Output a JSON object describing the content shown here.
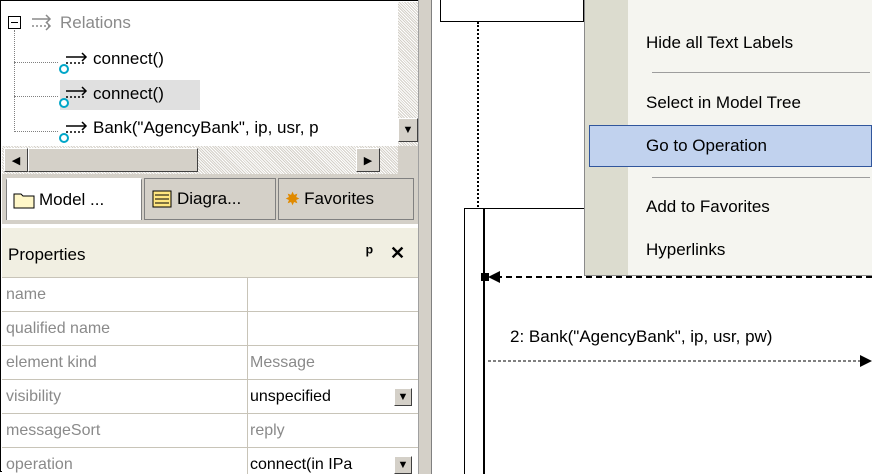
{
  "tree": {
    "group_label": "Relations",
    "items": [
      {
        "label": "connect()"
      },
      {
        "label": "connect()"
      },
      {
        "label": "Bank(\"AgencyBank\", ip, usr, p"
      }
    ]
  },
  "tabs": [
    {
      "label": "Model ..."
    },
    {
      "label": "Diagra..."
    },
    {
      "label": "Favorites"
    }
  ],
  "properties": {
    "title": "Properties",
    "pin_glyph": "ᵖ",
    "close_glyph": "✕",
    "rows": [
      {
        "name": "name",
        "value": ""
      },
      {
        "name": "qualified name",
        "value": ""
      },
      {
        "name": "element kind",
        "value": "Message"
      },
      {
        "name": "visibility",
        "value": "unspecified"
      },
      {
        "name": "messageSort",
        "value": "reply"
      },
      {
        "name": "operation",
        "value": "connect(in IPa"
      }
    ]
  },
  "context_menu": {
    "items": [
      {
        "label": "Hide all Text Labels"
      },
      {
        "label": "Select in Model Tree"
      },
      {
        "label": "Go to Operation",
        "highlighted": true
      },
      {
        "label": "Add to Favorites"
      },
      {
        "label": "Hyperlinks"
      }
    ]
  },
  "diagram": {
    "message_label": "2: Bank(\"AgencyBank\", ip, usr, pw)"
  },
  "colors": {
    "menu_highlight": "#c1d2ee",
    "menu_highlight_border": "#31569c",
    "chrome": "#d4d0c8",
    "grey_text": "#8a8a8a"
  }
}
